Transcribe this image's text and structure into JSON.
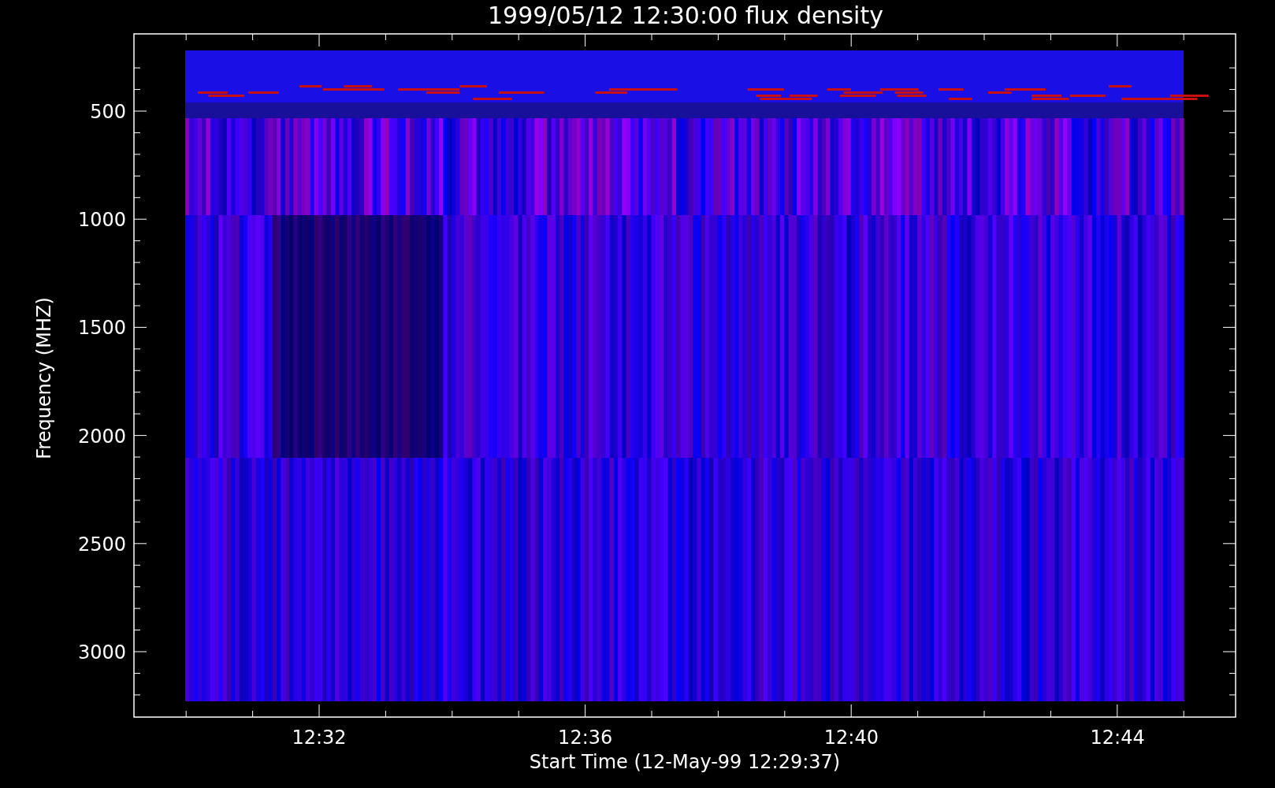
{
  "plot": {
    "title": "1999/05/12 12:30:00 flux density",
    "ylabel": "Frequency (MHZ)",
    "xlabel": "Start Time (12-May-99 12:29:37)",
    "yticks": [
      {
        "label": "500"
      },
      {
        "label": "1000"
      },
      {
        "label": "1500"
      },
      {
        "label": "2000"
      },
      {
        "label": "2500"
      },
      {
        "label": "3000"
      }
    ],
    "xticks": [
      {
        "label": "12:32"
      },
      {
        "label": "12:36"
      },
      {
        "label": "12:40"
      },
      {
        "label": "12:44"
      }
    ]
  }
}
